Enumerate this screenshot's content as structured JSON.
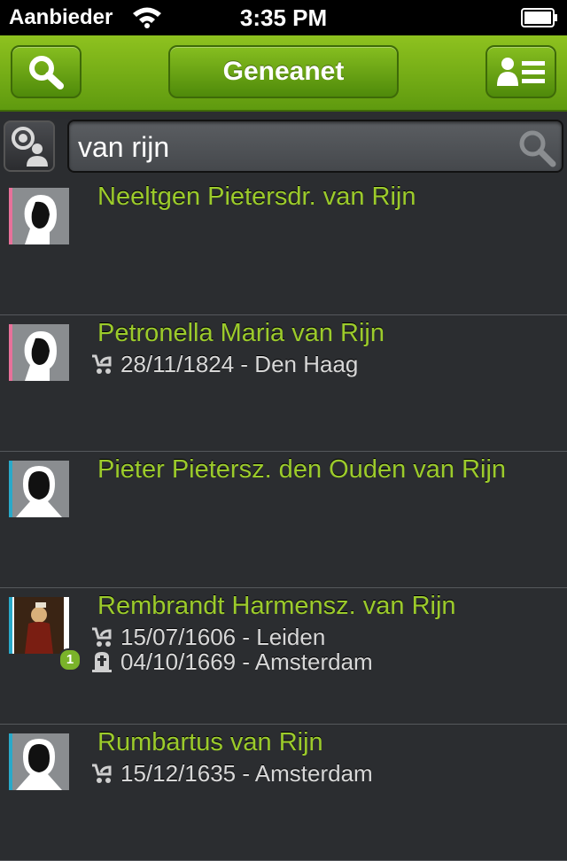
{
  "status_bar": {
    "carrier": "Aanbieder",
    "time": "3:35 PM"
  },
  "navbar": {
    "title": "Geneanet",
    "accent": "#7ab32a"
  },
  "search": {
    "query": "van rijn"
  },
  "results": [
    {
      "name": "Neeltgen Pietersdr. van Rijn",
      "sex": "female",
      "sex_color": "#e8719a",
      "events": []
    },
    {
      "name": "Petronella Maria van Rijn",
      "sex": "female",
      "sex_color": "#e8719a",
      "events": [
        {
          "type": "birth",
          "icon": "stroller-icon",
          "text": "28/11/1824 - Den Haag"
        }
      ]
    },
    {
      "name": "Pieter Pietersz. den Ouden van Rijn",
      "sex": "male",
      "sex_color": "#29a9c9",
      "events": []
    },
    {
      "name": "Rembrandt Harmensz. van Rijn",
      "sex": "male",
      "sex_color": "#29a9c9",
      "badge": "1",
      "events": [
        {
          "type": "birth",
          "icon": "stroller-icon",
          "text": "15/07/1606 - Leiden"
        },
        {
          "type": "death",
          "icon": "tombstone-icon",
          "text": "04/10/1669 - Amsterdam"
        }
      ]
    },
    {
      "name": "Rumbartus van Rijn",
      "sex": "male",
      "sex_color": "#29a9c9",
      "events": [
        {
          "type": "birth",
          "icon": "stroller-icon",
          "text": "15/12/1635 - Amsterdam"
        }
      ]
    }
  ]
}
